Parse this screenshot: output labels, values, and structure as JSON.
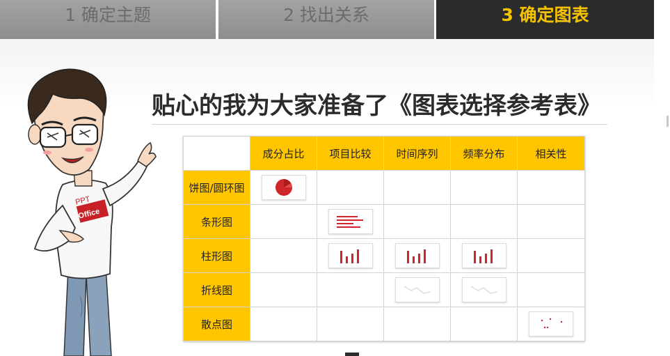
{
  "steps": [
    {
      "label": "1 确定主题"
    },
    {
      "label": "2 找出关系"
    },
    {
      "label": "3 确定图表"
    }
  ],
  "headline": "贴心的我为大家准备了《图表选择参考表》",
  "mascot": {
    "shirt_text_top": "PPT",
    "shirt_text_bottom": "Office"
  },
  "table": {
    "columns": [
      "成分占比",
      "项目比较",
      "时间序列",
      "频率分布",
      "相关性"
    ],
    "rows": [
      {
        "label": "饼图/圆环图",
        "cells": [
          "pie-thumb",
          "",
          "",
          "",
          ""
        ]
      },
      {
        "label": "条形图",
        "cells": [
          "",
          "bar-thumb",
          "",
          "",
          ""
        ]
      },
      {
        "label": "柱形图",
        "cells": [
          "",
          "column-thumb",
          "column-thumb",
          "column-thumb",
          ""
        ]
      },
      {
        "label": "折线图",
        "cells": [
          "",
          "",
          "line-thumb",
          "line-thumb",
          ""
        ]
      },
      {
        "label": "散点图",
        "cells": [
          "",
          "",
          "",
          "",
          "scatter-thumb"
        ]
      }
    ]
  },
  "colors": {
    "accent_yellow": "#ffc600",
    "active_tab_bg": "#2b2b2b",
    "active_tab_text": "#f5c200",
    "inactive_tab_bg": "#9a9a9a",
    "chart_red": "#cc1f1f"
  }
}
